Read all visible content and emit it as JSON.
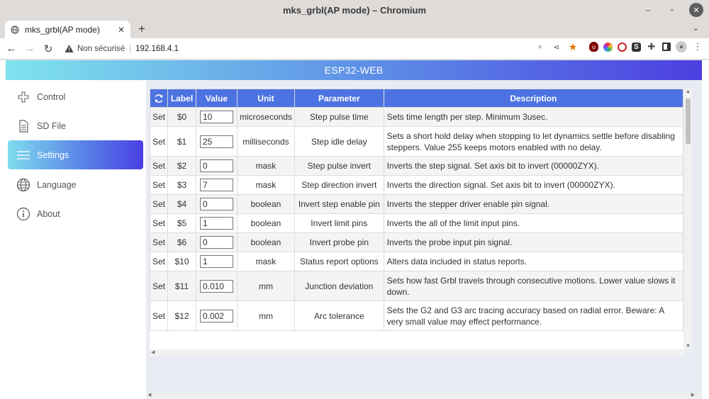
{
  "window": {
    "title": "mks_grbl(AP mode) – Chromium"
  },
  "tab": {
    "title": "mks_grbl(AP mode)"
  },
  "omnibox": {
    "security_label": "Non sécurisé",
    "url": "192.168.4.1"
  },
  "header": {
    "title": "ESP32-WEB"
  },
  "sidebar": {
    "items": [
      {
        "label": "Control",
        "icon": "gamepad-icon"
      },
      {
        "label": "SD File",
        "icon": "file-icon"
      },
      {
        "label": "Settings",
        "icon": "menu-icon"
      },
      {
        "label": "Language",
        "icon": "globe-icon"
      },
      {
        "label": "About",
        "icon": "info-icon"
      }
    ],
    "active_index": 2
  },
  "table": {
    "columns": [
      "",
      "Label",
      "Value",
      "Unit",
      "Parameter",
      "Description"
    ],
    "rows": [
      {
        "action": "Set",
        "label": "$0",
        "value": "10",
        "unit": "microseconds",
        "parameter": "Step pulse time",
        "description": "Sets time length per step. Minimum 3usec."
      },
      {
        "action": "Set",
        "label": "$1",
        "value": "25",
        "unit": "milliseconds",
        "parameter": "Step idle delay",
        "description": "Sets a short hold delay when stopping to let dynamics settle before disabling steppers. Value 255 keeps motors enabled with no delay."
      },
      {
        "action": "Set",
        "label": "$2",
        "value": "0",
        "unit": "mask",
        "parameter": "Step pulse invert",
        "description": "Inverts the step signal. Set axis bit to invert (00000ZYX)."
      },
      {
        "action": "Set",
        "label": "$3",
        "value": "7",
        "unit": "mask",
        "parameter": "Step direction invert",
        "description": "Inverts the direction signal. Set axis bit to invert (00000ZYX)."
      },
      {
        "action": "Set",
        "label": "$4",
        "value": "0",
        "unit": "boolean",
        "parameter": "Invert step enable pin",
        "description": "Inverts the stepper driver enable pin signal."
      },
      {
        "action": "Set",
        "label": "$5",
        "value": "1",
        "unit": "boolean",
        "parameter": "Invert limit pins",
        "description": "Inverts the all of the limit input pins."
      },
      {
        "action": "Set",
        "label": "$6",
        "value": "0",
        "unit": "boolean",
        "parameter": "Invert probe pin",
        "description": "Inverts the probe input pin signal."
      },
      {
        "action": "Set",
        "label": "$10",
        "value": "1",
        "unit": "mask",
        "parameter": "Status report options",
        "description": "Alters data included in status reports."
      },
      {
        "action": "Set",
        "label": "$11",
        "value": "0.010",
        "unit": "mm",
        "parameter": "Junction deviation",
        "description": "Sets how fast Grbl travels through consecutive motions. Lower value slows it down."
      },
      {
        "action": "Set",
        "label": "$12",
        "value": "0.002",
        "unit": "mm",
        "parameter": "Arc tolerance",
        "description": "Sets the G2 and G3 arc tracing accuracy based on radial error. Beware: A very small value may effect performance."
      }
    ]
  },
  "colors": {
    "table_header": "#4d73e2",
    "accent_start": "#7fe3ed",
    "accent_end": "#4c3fe0"
  }
}
